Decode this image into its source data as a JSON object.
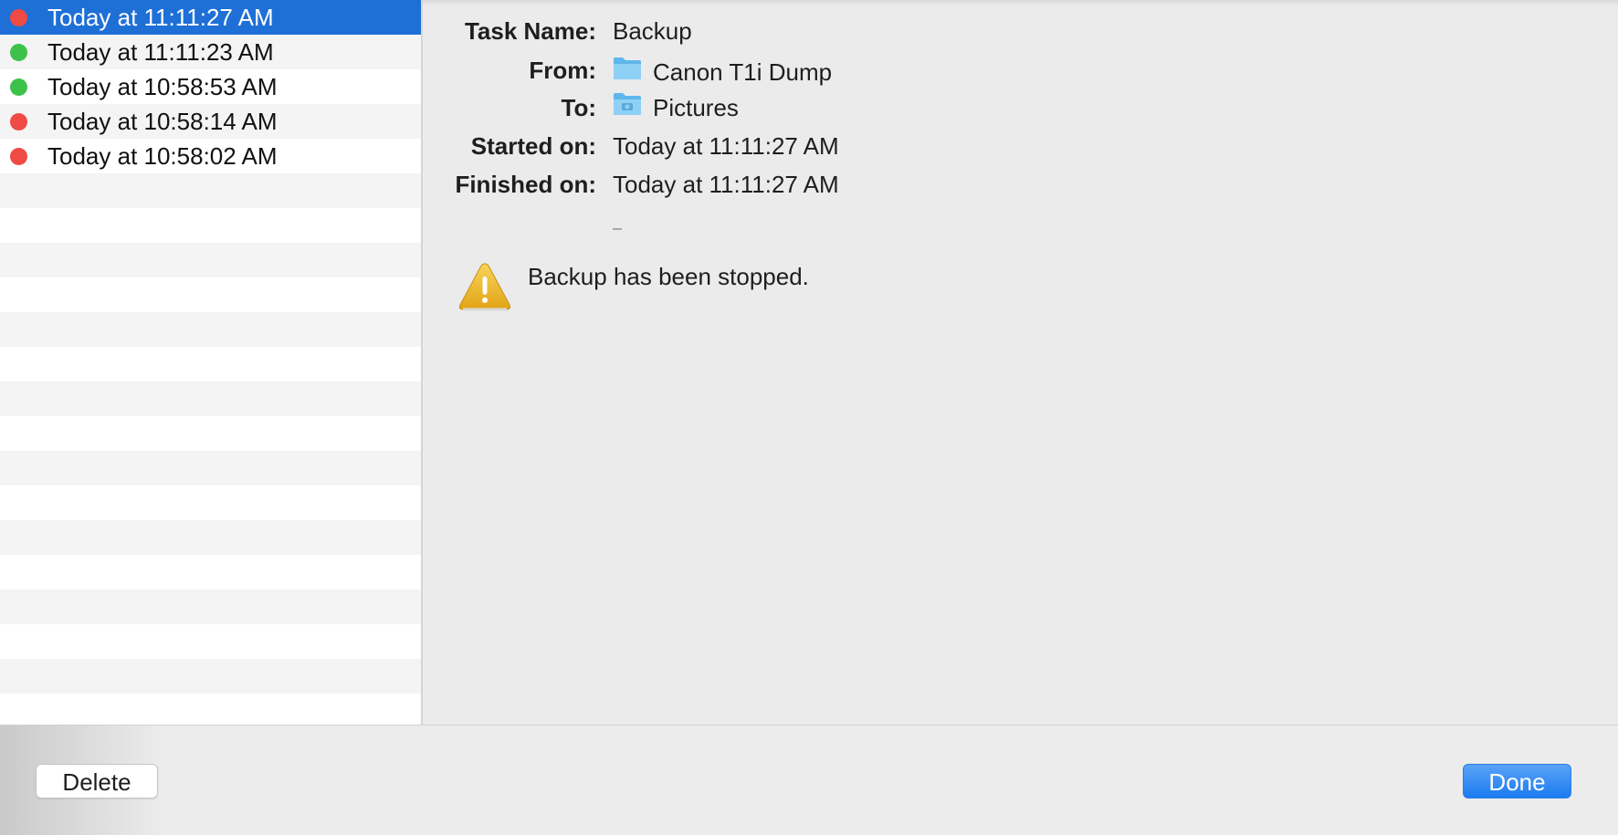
{
  "history": {
    "items": [
      {
        "label": "Today at 11:11:27 AM",
        "status": "failed",
        "status_color": "#f04a44",
        "selected": true
      },
      {
        "label": "Today at 11:11:23 AM",
        "status": "success",
        "status_color": "#3cc24a",
        "selected": false
      },
      {
        "label": "Today at 10:58:53 AM",
        "status": "success",
        "status_color": "#3cc24a",
        "selected": false
      },
      {
        "label": "Today at 10:58:14 AM",
        "status": "failed",
        "status_color": "#f04a44",
        "selected": false
      },
      {
        "label": "Today at 10:58:02 AM",
        "status": "failed",
        "status_color": "#f04a44",
        "selected": false
      }
    ],
    "selected_color": "#1e6fd6"
  },
  "details": {
    "task_name_label": "Task Name:",
    "task_name": "Backup",
    "from_label": "From:",
    "from_value": "Canon T1i Dump",
    "from_icon": "folder-icon",
    "to_label": "To:",
    "to_value": "Pictures",
    "to_icon": "pictures-folder-icon",
    "started_label": "Started on:",
    "started_value": "Today at 11:11:27 AM",
    "finished_label": "Finished on:",
    "finished_value": "Today at 11:11:27 AM",
    "message_icon": "warning-icon",
    "message": "Backup has been stopped."
  },
  "footer": {
    "delete_label": "Delete",
    "done_label": "Done",
    "accent": "#1b7bf0"
  }
}
